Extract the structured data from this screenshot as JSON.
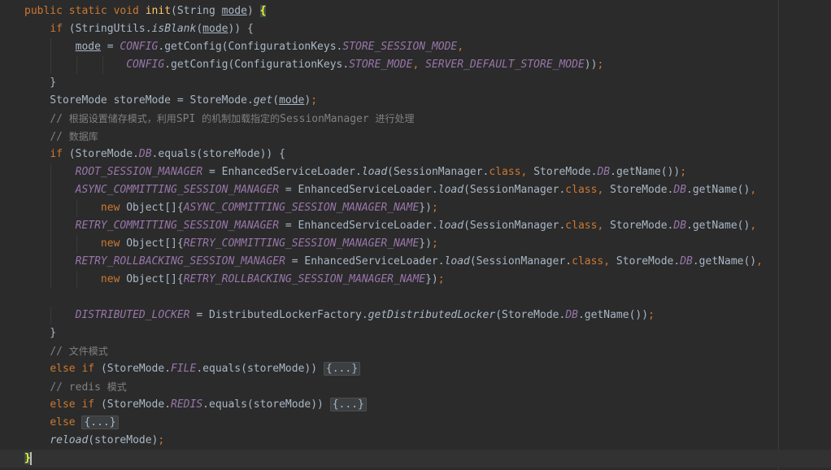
{
  "editor": {
    "lines": [
      [
        {
          "t": "public static void ",
          "c": "kw"
        },
        {
          "t": "init",
          "c": "method"
        },
        {
          "t": "(String "
        },
        {
          "t": "mode",
          "c": "param"
        },
        {
          "t": ") "
        },
        {
          "t": "{",
          "c": "brace-match"
        }
      ],
      [
        {
          "t": "    "
        },
        {
          "t": "if ",
          "c": "kw"
        },
        {
          "t": "(StringUtils."
        },
        {
          "t": "isBlank",
          "c": "static-call"
        },
        {
          "t": "("
        },
        {
          "t": "mode",
          "c": "param"
        },
        {
          "t": ")) {"
        }
      ],
      [
        {
          "t": "        "
        },
        {
          "t": "mode",
          "c": "param"
        },
        {
          "t": " = "
        },
        {
          "t": "CONFIG",
          "c": "field"
        },
        {
          "t": ".getConfig(ConfigurationKeys."
        },
        {
          "t": "STORE_SESSION_MODE",
          "c": "field"
        },
        {
          "t": ",",
          "c": "punct"
        }
      ],
      [
        {
          "t": "                "
        },
        {
          "t": "CONFIG",
          "c": "field"
        },
        {
          "t": ".getConfig(ConfigurationKeys."
        },
        {
          "t": "STORE_MODE",
          "c": "field"
        },
        {
          "t": ", ",
          "c": "punct"
        },
        {
          "t": "SERVER_DEFAULT_STORE_MODE",
          "c": "field"
        },
        {
          "t": "))"
        },
        {
          "t": ";",
          "c": "punct"
        }
      ],
      [
        {
          "t": "    }"
        }
      ],
      [
        {
          "t": "    StoreMode storeMode = StoreMode."
        },
        {
          "t": "get",
          "c": "static-call"
        },
        {
          "t": "("
        },
        {
          "t": "mode",
          "c": "param"
        },
        {
          "t": ")"
        },
        {
          "t": ";",
          "c": "punct"
        }
      ],
      [
        {
          "t": "    "
        },
        {
          "t": "// ",
          "c": "comment"
        },
        {
          "t": "根据设置储存模式，利用",
          "c": "comment cjk"
        },
        {
          "t": "SPI ",
          "c": "comment"
        },
        {
          "t": "的机制加载指定的",
          "c": "comment cjk"
        },
        {
          "t": "SessionManager ",
          "c": "comment"
        },
        {
          "t": "进行处理",
          "c": "comment cjk"
        }
      ],
      [
        {
          "t": "    "
        },
        {
          "t": "// ",
          "c": "comment"
        },
        {
          "t": "数据库",
          "c": "comment cjk"
        }
      ],
      [
        {
          "t": "    "
        },
        {
          "t": "if ",
          "c": "kw"
        },
        {
          "t": "(StoreMode."
        },
        {
          "t": "DB",
          "c": "field"
        },
        {
          "t": ".equals(storeMode)) {"
        }
      ],
      [
        {
          "t": "        "
        },
        {
          "t": "ROOT_SESSION_MANAGER",
          "c": "field"
        },
        {
          "t": " = EnhancedServiceLoader."
        },
        {
          "t": "load",
          "c": "static-call"
        },
        {
          "t": "(SessionManager."
        },
        {
          "t": "class",
          "c": "kw"
        },
        {
          "t": ", ",
          "c": "punct"
        },
        {
          "t": "StoreMode."
        },
        {
          "t": "DB",
          "c": "field"
        },
        {
          "t": ".getName())"
        },
        {
          "t": ";",
          "c": "punct"
        }
      ],
      [
        {
          "t": "        "
        },
        {
          "t": "ASYNC_COMMITTING_SESSION_MANAGER",
          "c": "field"
        },
        {
          "t": " = EnhancedServiceLoader."
        },
        {
          "t": "load",
          "c": "static-call"
        },
        {
          "t": "(SessionManager."
        },
        {
          "t": "class",
          "c": "kw"
        },
        {
          "t": ", ",
          "c": "punct"
        },
        {
          "t": "StoreMode."
        },
        {
          "t": "DB",
          "c": "field"
        },
        {
          "t": ".getName()"
        },
        {
          "t": ",",
          "c": "punct"
        }
      ],
      [
        {
          "t": "            "
        },
        {
          "t": "new ",
          "c": "kw"
        },
        {
          "t": "Object[]{"
        },
        {
          "t": "ASYNC_COMMITTING_SESSION_MANAGER_NAME",
          "c": "field"
        },
        {
          "t": "})"
        },
        {
          "t": ";",
          "c": "punct"
        }
      ],
      [
        {
          "t": "        "
        },
        {
          "t": "RETRY_COMMITTING_SESSION_MANAGER",
          "c": "field"
        },
        {
          "t": " = EnhancedServiceLoader."
        },
        {
          "t": "load",
          "c": "static-call"
        },
        {
          "t": "(SessionManager."
        },
        {
          "t": "class",
          "c": "kw"
        },
        {
          "t": ", ",
          "c": "punct"
        },
        {
          "t": "StoreMode."
        },
        {
          "t": "DB",
          "c": "field"
        },
        {
          "t": ".getName()"
        },
        {
          "t": ",",
          "c": "punct"
        }
      ],
      [
        {
          "t": "            "
        },
        {
          "t": "new ",
          "c": "kw"
        },
        {
          "t": "Object[]{"
        },
        {
          "t": "RETRY_COMMITTING_SESSION_MANAGER_NAME",
          "c": "field"
        },
        {
          "t": "})"
        },
        {
          "t": ";",
          "c": "punct"
        }
      ],
      [
        {
          "t": "        "
        },
        {
          "t": "RETRY_ROLLBACKING_SESSION_MANAGER",
          "c": "field"
        },
        {
          "t": " = EnhancedServiceLoader."
        },
        {
          "t": "load",
          "c": "static-call"
        },
        {
          "t": "(SessionManager."
        },
        {
          "t": "class",
          "c": "kw"
        },
        {
          "t": ", ",
          "c": "punct"
        },
        {
          "t": "StoreMode."
        },
        {
          "t": "DB",
          "c": "field"
        },
        {
          "t": ".getName()"
        },
        {
          "t": ",",
          "c": "punct"
        }
      ],
      [
        {
          "t": "            "
        },
        {
          "t": "new ",
          "c": "kw"
        },
        {
          "t": "Object[]{"
        },
        {
          "t": "RETRY_ROLLBACKING_SESSION_MANAGER_NAME",
          "c": "field"
        },
        {
          "t": "})"
        },
        {
          "t": ";",
          "c": "punct"
        }
      ],
      [],
      [
        {
          "t": "        "
        },
        {
          "t": "DISTRIBUTED_LOCKER",
          "c": "field"
        },
        {
          "t": " = DistributedLockerFactory."
        },
        {
          "t": "getDistributedLocker",
          "c": "static-call"
        },
        {
          "t": "(StoreMode."
        },
        {
          "t": "DB",
          "c": "field"
        },
        {
          "t": ".getName())"
        },
        {
          "t": ";",
          "c": "punct"
        }
      ],
      [
        {
          "t": "    }"
        }
      ],
      [
        {
          "t": "    "
        },
        {
          "t": "// ",
          "c": "comment"
        },
        {
          "t": "文件模式",
          "c": "comment cjk"
        }
      ],
      [
        {
          "t": "    "
        },
        {
          "t": "else if ",
          "c": "kw"
        },
        {
          "t": "(StoreMode."
        },
        {
          "t": "FILE",
          "c": "field"
        },
        {
          "t": ".equals(storeMode)) "
        },
        {
          "t": "{...}",
          "c": "fold"
        }
      ],
      [
        {
          "t": "    "
        },
        {
          "t": "// redis ",
          "c": "comment"
        },
        {
          "t": "模式",
          "c": "comment cjk"
        }
      ],
      [
        {
          "t": "    "
        },
        {
          "t": "else if ",
          "c": "kw"
        },
        {
          "t": "(StoreMode."
        },
        {
          "t": "REDIS",
          "c": "field"
        },
        {
          "t": ".equals(storeMode)) "
        },
        {
          "t": "{...}",
          "c": "fold"
        }
      ],
      [
        {
          "t": "    "
        },
        {
          "t": "else ",
          "c": "kw"
        },
        {
          "t": "{...}",
          "c": "fold"
        }
      ],
      [
        {
          "t": "    "
        },
        {
          "t": "reload",
          "c": "static-call"
        },
        {
          "t": "(storeMode)"
        },
        {
          "t": ";",
          "c": "punct"
        }
      ],
      [
        {
          "t": "}",
          "c": "brace-match"
        }
      ]
    ],
    "current_line": 25,
    "caret_line": 25
  }
}
